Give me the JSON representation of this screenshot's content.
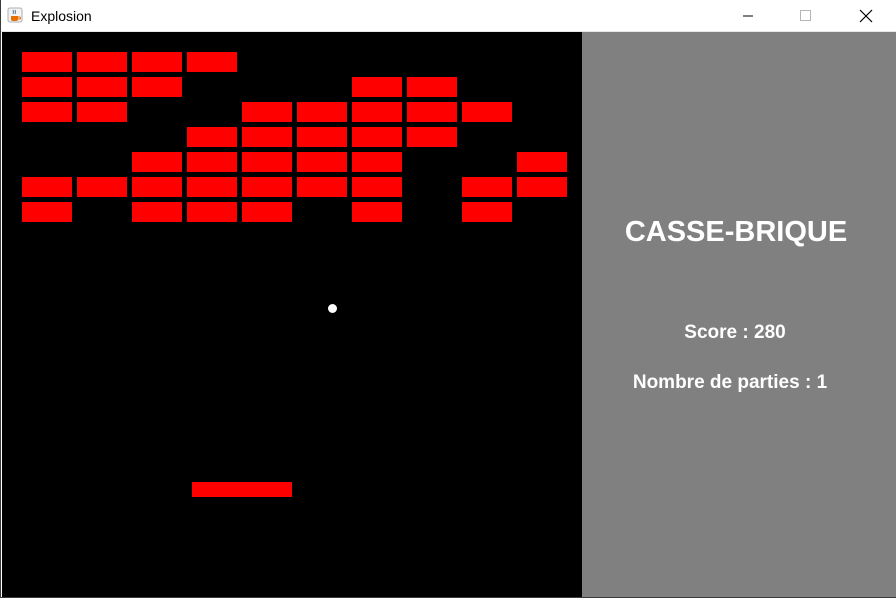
{
  "window": {
    "title": "Explosion",
    "icon": "java-cup-icon"
  },
  "controls": {
    "minimize": "minimize-icon",
    "maximize": "maximize-icon",
    "close": "close-icon"
  },
  "game": {
    "background": "#000000",
    "brick_color": "#ff0000",
    "ball_color": "#ffffff",
    "brick_rows": [
      [
        1,
        1,
        1,
        1,
        0,
        0,
        0,
        0,
        0,
        0
      ],
      [
        1,
        1,
        1,
        0,
        0,
        0,
        1,
        1,
        0,
        0
      ],
      [
        1,
        1,
        0,
        0,
        1,
        1,
        1,
        1,
        1,
        0
      ],
      [
        0,
        0,
        0,
        1,
        1,
        1,
        1,
        1,
        0,
        0
      ],
      [
        0,
        0,
        1,
        1,
        1,
        1,
        1,
        0,
        0,
        1
      ],
      [
        1,
        1,
        1,
        1,
        1,
        1,
        1,
        0,
        1,
        1
      ],
      [
        1,
        0,
        1,
        1,
        1,
        0,
        1,
        0,
        1,
        0
      ]
    ]
  },
  "panel": {
    "background": "#808080",
    "title": "CASSE-BRIQUE",
    "score_label": "Score : ",
    "score_value": "280",
    "parties_label": "Nombre de parties : ",
    "parties_value": "1"
  }
}
